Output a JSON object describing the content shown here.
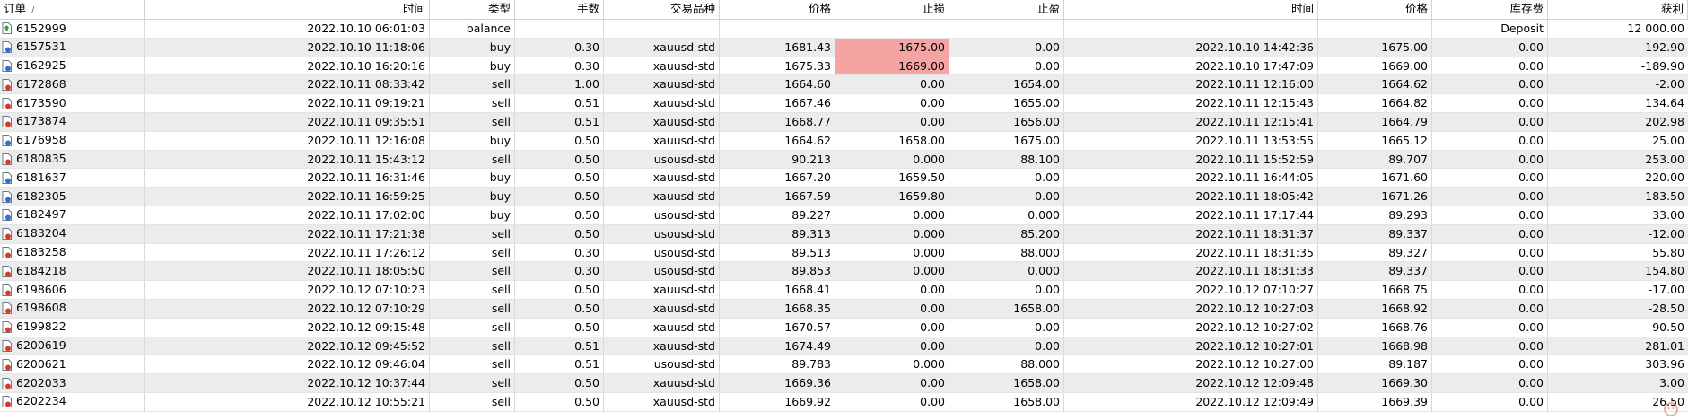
{
  "colors": {
    "stop_loss_hit": "#f5a3a3",
    "row_alt": "#ececec",
    "row_normal": "#ffffff"
  },
  "header": {
    "columns": [
      "订单",
      "时间",
      "类型",
      "手数",
      "交易品种",
      "价格",
      "止损",
      "止盈",
      "时间",
      "价格",
      "库存费",
      "获利"
    ],
    "sort_indicator": "/"
  },
  "rows": [
    {
      "icon": "balance-icon",
      "cells": [
        "6152999",
        "2022.10.10 06:01:03",
        "balance",
        "",
        "",
        "",
        "",
        "",
        "",
        "",
        "Deposit",
        "12 000.00"
      ]
    },
    {
      "icon": "buy-order-icon",
      "cells": [
        "6157531",
        "2022.10.10 11:18:06",
        "buy",
        "0.30",
        "xauusd-std",
        "1681.43",
        "1675.00",
        "0.00",
        "2022.10.10 14:42:36",
        "1675.00",
        "0.00",
        "-192.90"
      ],
      "sl_hit": true
    },
    {
      "icon": "buy-order-icon",
      "cells": [
        "6162925",
        "2022.10.10 16:20:16",
        "buy",
        "0.30",
        "xauusd-std",
        "1675.33",
        "1669.00",
        "0.00",
        "2022.10.10 17:47:09",
        "1669.00",
        "0.00",
        "-189.90"
      ],
      "sl_hit": true
    },
    {
      "icon": "sell-order-icon",
      "cells": [
        "6172868",
        "2022.10.11 08:33:42",
        "sell",
        "1.00",
        "xauusd-std",
        "1664.60",
        "0.00",
        "1654.00",
        "2022.10.11 12:16:00",
        "1664.62",
        "0.00",
        "-2.00"
      ]
    },
    {
      "icon": "sell-order-icon",
      "cells": [
        "6173590",
        "2022.10.11 09:19:21",
        "sell",
        "0.51",
        "xauusd-std",
        "1667.46",
        "0.00",
        "1655.00",
        "2022.10.11 12:15:43",
        "1664.82",
        "0.00",
        "134.64"
      ]
    },
    {
      "icon": "sell-order-icon",
      "cells": [
        "6173874",
        "2022.10.11 09:35:51",
        "sell",
        "0.51",
        "xauusd-std",
        "1668.77",
        "0.00",
        "1656.00",
        "2022.10.11 12:15:41",
        "1664.79",
        "0.00",
        "202.98"
      ]
    },
    {
      "icon": "buy-order-icon",
      "cells": [
        "6176958",
        "2022.10.11 12:16:08",
        "buy",
        "0.50",
        "xauusd-std",
        "1664.62",
        "1658.00",
        "1675.00",
        "2022.10.11 13:53:55",
        "1665.12",
        "0.00",
        "25.00"
      ]
    },
    {
      "icon": "sell-order-icon",
      "cells": [
        "6180835",
        "2022.10.11 15:43:12",
        "sell",
        "0.50",
        "usousd-std",
        "90.213",
        "0.000",
        "88.100",
        "2022.10.11 15:52:59",
        "89.707",
        "0.00",
        "253.00"
      ]
    },
    {
      "icon": "buy-order-icon",
      "cells": [
        "6181637",
        "2022.10.11 16:31:46",
        "buy",
        "0.50",
        "xauusd-std",
        "1667.20",
        "1659.50",
        "0.00",
        "2022.10.11 16:44:05",
        "1671.60",
        "0.00",
        "220.00"
      ]
    },
    {
      "icon": "buy-order-icon",
      "cells": [
        "6182305",
        "2022.10.11 16:59:25",
        "buy",
        "0.50",
        "xauusd-std",
        "1667.59",
        "1659.80",
        "0.00",
        "2022.10.11 18:05:42",
        "1671.26",
        "0.00",
        "183.50"
      ]
    },
    {
      "icon": "buy-order-icon",
      "cells": [
        "6182497",
        "2022.10.11 17:02:00",
        "buy",
        "0.50",
        "usousd-std",
        "89.227",
        "0.000",
        "0.000",
        "2022.10.11 17:17:44",
        "89.293",
        "0.00",
        "33.00"
      ]
    },
    {
      "icon": "sell-order-icon",
      "cells": [
        "6183204",
        "2022.10.11 17:21:38",
        "sell",
        "0.50",
        "usousd-std",
        "89.313",
        "0.000",
        "85.200",
        "2022.10.11 18:31:37",
        "89.337",
        "0.00",
        "-12.00"
      ]
    },
    {
      "icon": "sell-order-icon",
      "cells": [
        "6183258",
        "2022.10.11 17:26:12",
        "sell",
        "0.30",
        "usousd-std",
        "89.513",
        "0.000",
        "88.000",
        "2022.10.11 18:31:35",
        "89.327",
        "0.00",
        "55.80"
      ]
    },
    {
      "icon": "sell-order-icon",
      "cells": [
        "6184218",
        "2022.10.11 18:05:50",
        "sell",
        "0.30",
        "usousd-std",
        "89.853",
        "0.000",
        "0.000",
        "2022.10.11 18:31:33",
        "89.337",
        "0.00",
        "154.80"
      ]
    },
    {
      "icon": "sell-order-icon",
      "cells": [
        "6198606",
        "2022.10.12 07:10:23",
        "sell",
        "0.50",
        "xauusd-std",
        "1668.41",
        "0.00",
        "0.00",
        "2022.10.12 07:10:27",
        "1668.75",
        "0.00",
        "-17.00"
      ]
    },
    {
      "icon": "sell-order-icon",
      "cells": [
        "6198608",
        "2022.10.12 07:10:29",
        "sell",
        "0.50",
        "xauusd-std",
        "1668.35",
        "0.00",
        "1658.00",
        "2022.10.12 10:27:03",
        "1668.92",
        "0.00",
        "-28.50"
      ]
    },
    {
      "icon": "sell-order-icon",
      "cells": [
        "6199822",
        "2022.10.12 09:15:48",
        "sell",
        "0.50",
        "xauusd-std",
        "1670.57",
        "0.00",
        "0.00",
        "2022.10.12 10:27:02",
        "1668.76",
        "0.00",
        "90.50"
      ]
    },
    {
      "icon": "sell-order-icon",
      "cells": [
        "6200619",
        "2022.10.12 09:45:52",
        "sell",
        "0.51",
        "xauusd-std",
        "1674.49",
        "0.00",
        "0.00",
        "2022.10.12 10:27:01",
        "1668.98",
        "0.00",
        "281.01"
      ]
    },
    {
      "icon": "sell-order-icon",
      "cells": [
        "6200621",
        "2022.10.12 09:46:04",
        "sell",
        "0.51",
        "usousd-std",
        "89.783",
        "0.000",
        "88.000",
        "2022.10.12 10:27:00",
        "89.187",
        "0.00",
        "303.96"
      ]
    },
    {
      "icon": "sell-order-icon",
      "cells": [
        "6202033",
        "2022.10.12 10:37:44",
        "sell",
        "0.50",
        "xauusd-std",
        "1669.36",
        "0.00",
        "1658.00",
        "2022.10.12 12:09:48",
        "1669.30",
        "0.00",
        "3.00"
      ]
    },
    {
      "icon": "sell-order-icon",
      "cells": [
        "6202234",
        "2022.10.12 10:55:21",
        "sell",
        "0.50",
        "xauusd-std",
        "1669.92",
        "0.00",
        "1658.00",
        "2022.10.12 12:09:49",
        "1669.39",
        "0.00",
        "26.50"
      ]
    }
  ]
}
